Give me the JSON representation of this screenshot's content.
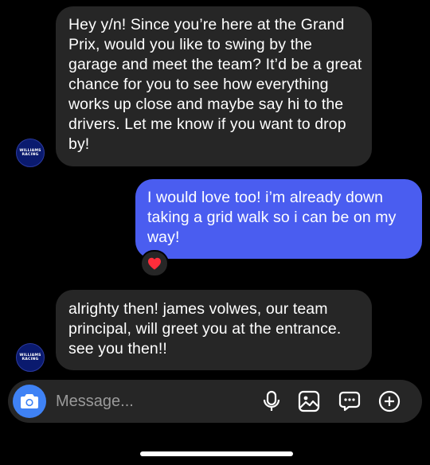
{
  "conversation": {
    "messages": [
      {
        "direction": "incoming",
        "text": "Hey y/n! Since you’re here at the Grand Prix, would you like to swing by the garage and meet the team? It’d be a great chance for you to see how everything works up close and maybe say hi to the drivers. Let me know if you want to drop by!"
      },
      {
        "direction": "outgoing",
        "text": "I would love too! i’m already down taking a grid walk so i can be on my way!",
        "reaction": "❤️"
      },
      {
        "direction": "incoming",
        "text": "alrighty then! james volwes, our team principal, will greet you at the entrance. see you then!!"
      }
    ],
    "avatar": {
      "line1": "WILLIAMS",
      "line2": "RACING"
    }
  },
  "composer": {
    "placeholder": "Message...",
    "icons": [
      "camera-icon",
      "microphone-icon",
      "gallery-icon",
      "sticker-icon",
      "add-icon"
    ]
  },
  "colors": {
    "background": "#000000",
    "incoming_bubble": "#262626",
    "outgoing_bubble": "#4a5df0",
    "camera_button": "#3f82f5",
    "placeholder": "#9a9a9a"
  }
}
